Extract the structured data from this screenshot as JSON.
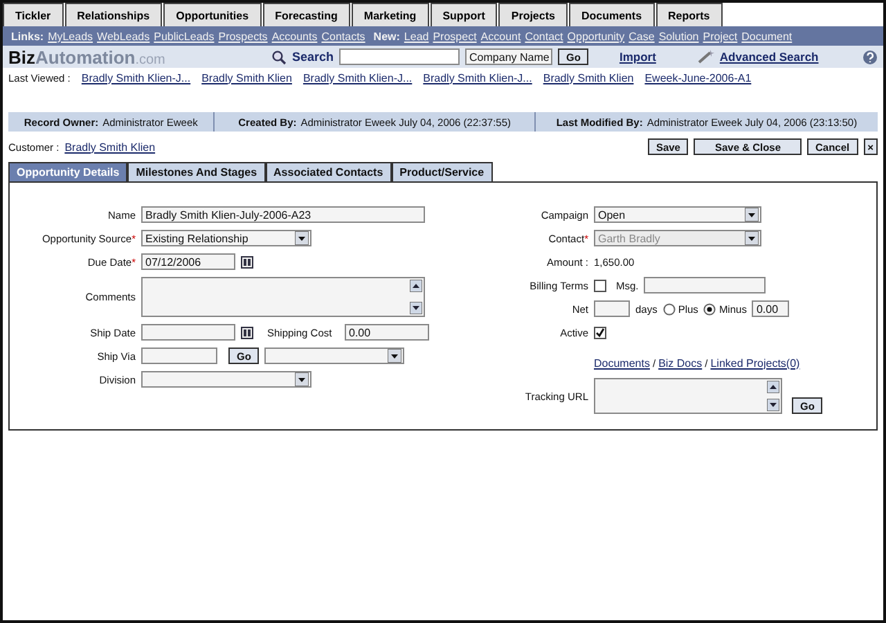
{
  "nav_tabs": [
    {
      "label": "Tickler",
      "selected": false
    },
    {
      "label": "Relationships",
      "selected": false
    },
    {
      "label": "Opportunities",
      "selected": false
    },
    {
      "label": "Forecasting",
      "selected": false
    },
    {
      "label": "Marketing",
      "selected": false
    },
    {
      "label": "Support",
      "selected": false
    },
    {
      "label": "Projects",
      "selected": false
    },
    {
      "label": "Documents",
      "selected": false
    },
    {
      "label": "Reports",
      "selected": false
    }
  ],
  "links_bar": {
    "links_label": "Links:",
    "links": [
      "MyLeads",
      "WebLeads",
      "PublicLeads",
      "Prospects",
      "Accounts",
      "Contacts"
    ],
    "new_label": "New:",
    "new_links": [
      "Lead",
      "Prospect",
      "Account",
      "Contact",
      "Opportunity",
      "Case",
      "Solution",
      "Project",
      "Document"
    ]
  },
  "header": {
    "logo_bold": "Biz",
    "logo_main": "Automation",
    "logo_suffix": ".com",
    "search_label": "Search",
    "search_scope": "Company Name",
    "go": "Go",
    "import": "Import",
    "advanced_search": "Advanced Search"
  },
  "last_viewed": {
    "label": "Last Viewed :",
    "items": [
      "Bradly Smith Klien-J...",
      "Bradly Smith Klien",
      "Bradly Smith Klien-J...",
      "Bradly Smith Klien-J...",
      "Bradly Smith Klien",
      "Eweek-June-2006-A1"
    ]
  },
  "record_bar": [
    {
      "label": "Record Owner:",
      "value": "Administrator Eweek"
    },
    {
      "label": "Created By:",
      "value": "Administrator Eweek July 04, 2006 (22:37:55)"
    },
    {
      "label": "Last Modified By:",
      "value": "Administrator Eweek July 04, 2006 (23:13:50)"
    }
  ],
  "customer": {
    "label": "Customer :",
    "name": "Bradly Smith Klien"
  },
  "actions": [
    "Save",
    "Save & Close",
    "Cancel",
    "×"
  ],
  "form_tabs": [
    {
      "label": "Opportunity Details",
      "selected": true
    },
    {
      "label": "Milestones And Stages",
      "selected": false
    },
    {
      "label": "Associated Contacts",
      "selected": false
    },
    {
      "label": "Product/Service",
      "selected": false
    }
  ],
  "left_fields": [
    {
      "kind": "text",
      "label": "Name",
      "value": "Bradly Smith Klien-July-2006-A23"
    },
    {
      "kind": "select",
      "label": "Opportunity Source",
      "mark": "*",
      "value": "Existing Relationship"
    },
    {
      "kind": "date",
      "label": "Due Date",
      "mark": "*",
      "value": "07/12/2006"
    },
    {
      "kind": "textarea",
      "label": "Comments"
    },
    {
      "kind": "date_cost",
      "label": "Ship Date",
      "cost_label": "Shipping Cost",
      "cost_value": "0.00"
    },
    {
      "kind": "ship_via",
      "label": "Ship Via",
      "go": "Go"
    },
    {
      "kind": "select",
      "label": "Division"
    }
  ],
  "right_fields": [
    {
      "kind": "select",
      "label": "Campaign",
      "value": "Open",
      "disabled": false
    },
    {
      "kind": "select",
      "label": "Contact",
      "mark": "*",
      "value": "Garth Bradly",
      "disabled": true
    },
    {
      "kind": "readout",
      "label": "Amount :",
      "value": "1,650.00"
    },
    {
      "kind": "billing",
      "label": "Billing Terms",
      "checked": false,
      "msg_label": "Msg."
    },
    {
      "kind": "net",
      "label": "Net",
      "days": "days",
      "options": [
        {
          "label": "Plus",
          "selected": false
        },
        {
          "label": "Minus",
          "selected": true
        }
      ],
      "value": "0.00"
    },
    {
      "kind": "check",
      "label": "Active",
      "checked": true
    },
    {
      "kind": "links",
      "links": [
        "Documents",
        "Biz Docs",
        "Linked Projects(0)"
      ],
      "separator": "/"
    },
    {
      "kind": "tracking",
      "label": "Tracking URL",
      "go": "Go"
    }
  ]
}
